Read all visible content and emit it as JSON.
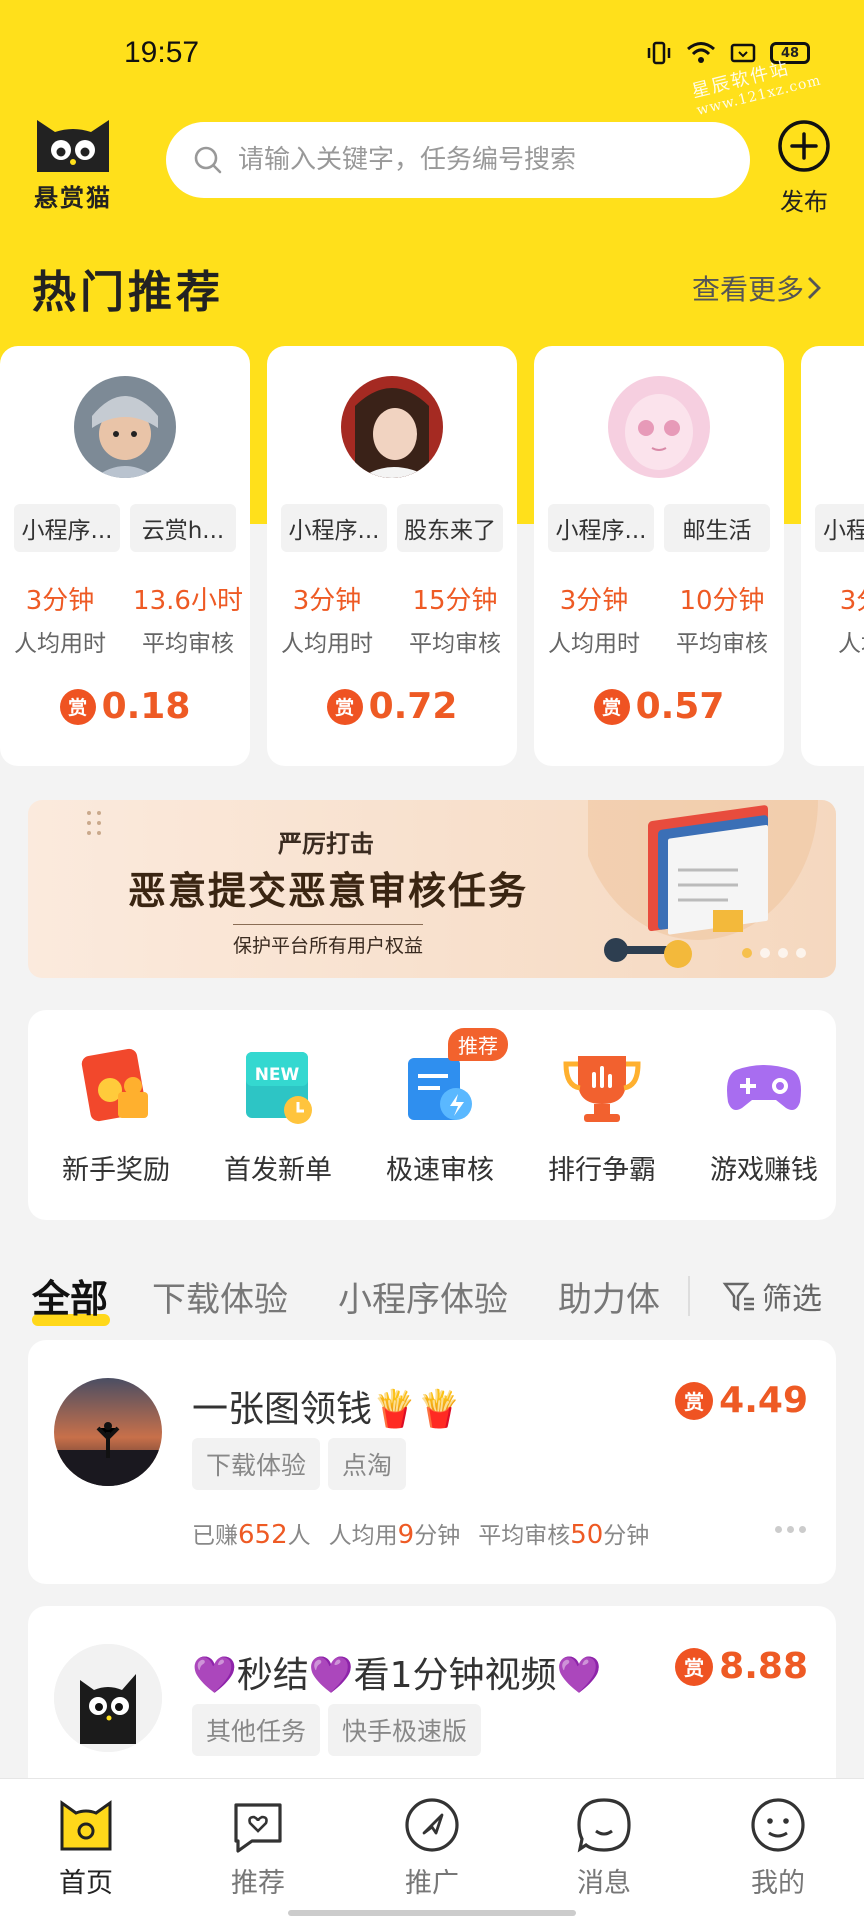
{
  "status_bar": {
    "time": "19:57",
    "battery": "48",
    "watermark_line1": "星辰软件站",
    "watermark_line2": "www.121xz.com"
  },
  "header": {
    "logo_text": "悬赏猫",
    "search_placeholder": "请输入关键字，任务编号搜索",
    "publish_label": "发布"
  },
  "hot": {
    "title": "热门推荐",
    "see_more": "查看更多",
    "cards": [
      {
        "tags": [
          "小程序...",
          "云赏h..."
        ],
        "avg_time": "3分钟",
        "avg_time_label": "人均用时",
        "avg_review": "13.6小时",
        "avg_review_label": "平均审核",
        "reward_badge": "赏",
        "reward": "0.18"
      },
      {
        "tags": [
          "小程序...",
          "股东来了"
        ],
        "avg_time": "3分钟",
        "avg_time_label": "人均用时",
        "avg_review": "15分钟",
        "avg_review_label": "平均审核",
        "reward_badge": "赏",
        "reward": "0.72"
      },
      {
        "tags": [
          "小程序...",
          "邮生活"
        ],
        "avg_time": "3分钟",
        "avg_time_label": "人均用时",
        "avg_review": "10分钟",
        "avg_review_label": "平均审核",
        "reward_badge": "赏",
        "reward": "0.57"
      },
      {
        "tags": [
          "小程",
          ""
        ],
        "avg_time": "3分",
        "avg_time_label": "人均",
        "avg_review": "",
        "avg_review_label": "",
        "reward_badge": "",
        "reward": ""
      }
    ]
  },
  "banner": {
    "line1": "严厉打击",
    "line2": "恶意提交恶意审核任务",
    "line3": "保护平台所有用户权益"
  },
  "quick_actions": [
    {
      "label": "新手奖励",
      "icon": "red-envelope-icon"
    },
    {
      "label": "首发新单",
      "icon": "new-order-icon"
    },
    {
      "label": "极速审核",
      "icon": "fast-review-icon",
      "badge": "推荐"
    },
    {
      "label": "排行争霸",
      "icon": "trophy-icon"
    },
    {
      "label": "游戏赚钱",
      "icon": "gamepad-icon"
    }
  ],
  "tabs": {
    "items": [
      "全部",
      "下载体验",
      "小程序体验",
      "助力体"
    ],
    "filter_label": "筛选"
  },
  "tasks": [
    {
      "title": "一张图领钱🍟🍟",
      "tags": [
        "下载体验",
        "点淘"
      ],
      "reward_badge": "赏",
      "reward": "4.49",
      "earned_prefix": "已赚",
      "earned": "652",
      "earned_suffix": "人",
      "avg_prefix": "人均用",
      "avg": "9",
      "avg_suffix": "分钟",
      "review_prefix": "平均审核",
      "review": "50",
      "review_suffix": "分钟"
    },
    {
      "title": "💜秒结💜看1分钟视频💜",
      "tags": [
        "其他任务",
        "快手极速版"
      ],
      "reward_badge": "赏",
      "reward": "8.88"
    }
  ],
  "bottom_nav": [
    {
      "label": "首页",
      "icon": "cat-home-icon",
      "active": true
    },
    {
      "label": "推荐",
      "icon": "chat-heart-icon"
    },
    {
      "label": "推广",
      "icon": "compass-icon"
    },
    {
      "label": "消息",
      "icon": "message-icon"
    },
    {
      "label": "我的",
      "icon": "smile-face-icon"
    }
  ],
  "colors": {
    "brand_yellow": "#ffe01b",
    "accent_orange": "#ee5a24",
    "reward_badge": "#ef5322"
  }
}
